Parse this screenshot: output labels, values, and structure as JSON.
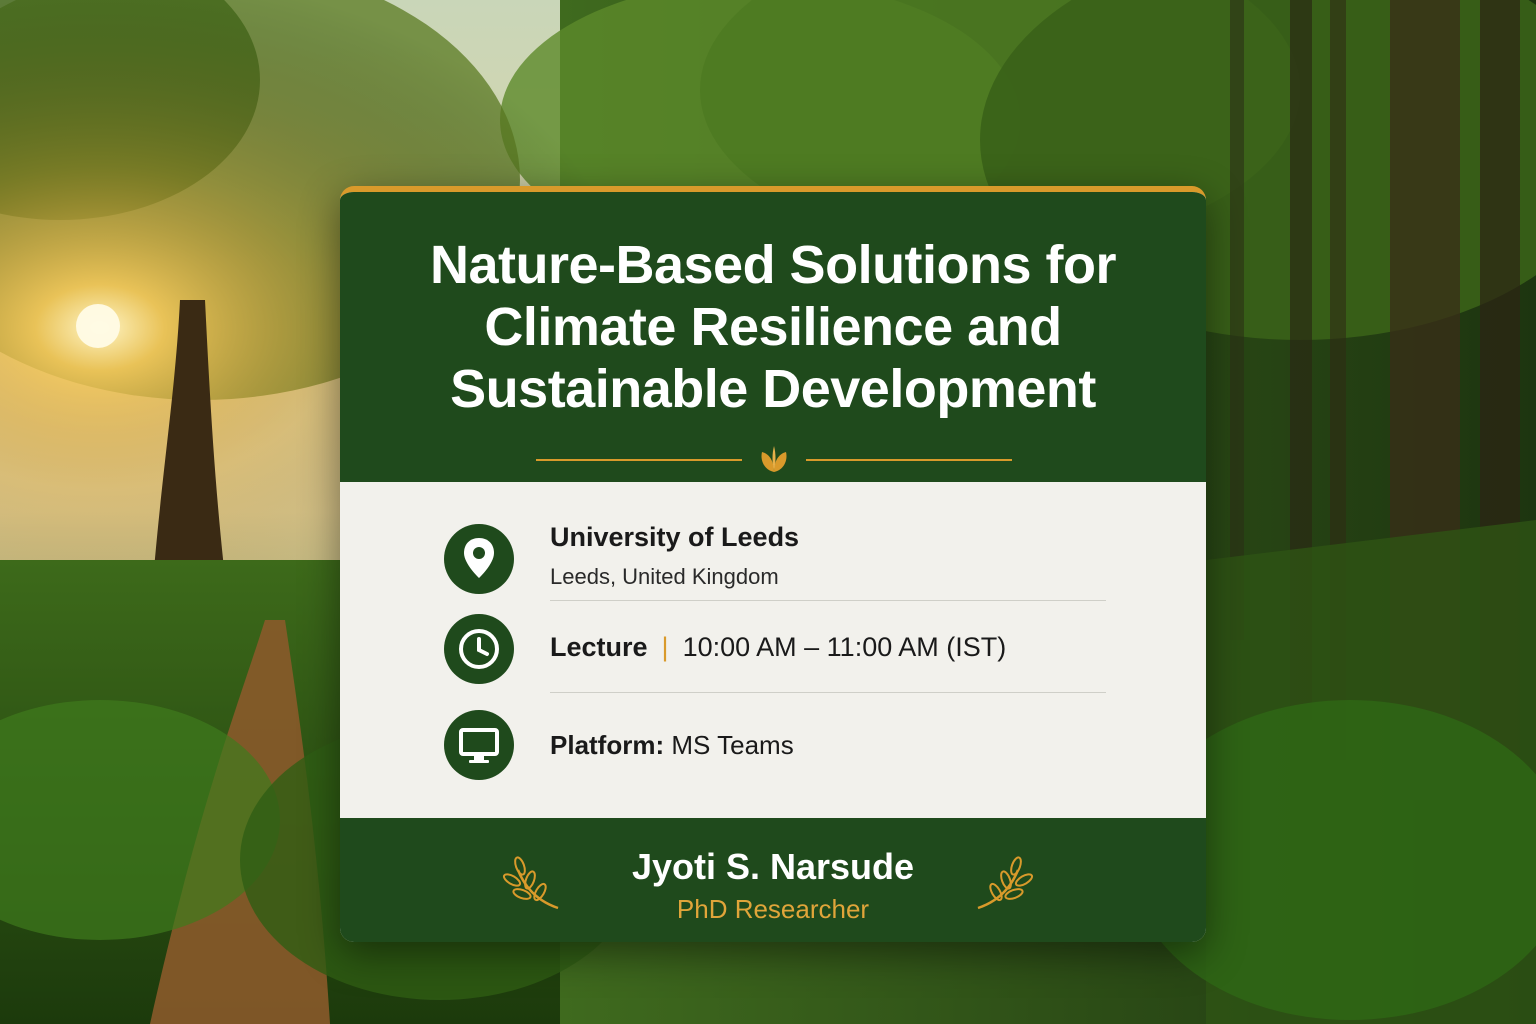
{
  "title_lines": [
    "Nature-Based Solutions for",
    "Climate Resilience and",
    "Sustainable Development"
  ],
  "venue": {
    "name": "University of Leeds",
    "location": "Leeds, United Kingdom"
  },
  "session": {
    "type": "Lecture",
    "time": "10:00 AM – 11:00 AM (IST)"
  },
  "platform": {
    "label": "Platform:",
    "name": "MS Teams"
  },
  "presenter": {
    "name": "Jyoti S. Narsude",
    "role": "PhD Researcher"
  },
  "colors": {
    "primary_green": "#1f4a1c",
    "accent_gold": "#d99a2b",
    "body_bg": "#f2f1ec"
  },
  "icons": [
    "location-pin-icon",
    "clock-icon",
    "monitor-icon",
    "leaf-icon",
    "laurel-icon"
  ]
}
